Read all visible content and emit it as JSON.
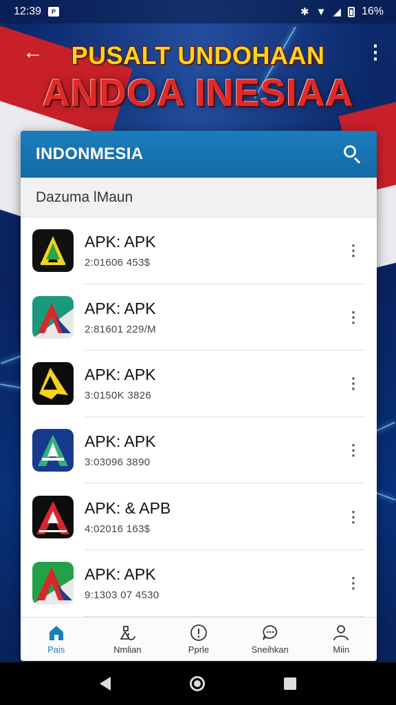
{
  "status_bar": {
    "time": "12:39",
    "battery_text": "16%"
  },
  "header": {
    "title_line1": "PUSALT UNDOHAAN",
    "title_line2": "ANDOA INESIAA"
  },
  "card": {
    "title": "INDONMESIA",
    "subheader": "Dazuma lMaun"
  },
  "apps": [
    {
      "name": "APK: APK",
      "meta": "2:01606  453$",
      "icon": "app-icon-green-yellow"
    },
    {
      "name": "APK: APK",
      "meta": "2:81601  229/M",
      "icon": "app-icon-teal-red"
    },
    {
      "name": "APK: APK",
      "meta": "3:0150K  3826",
      "icon": "app-icon-yellow-black"
    },
    {
      "name": "APK: APK",
      "meta": "3:03096  3890",
      "icon": "app-icon-blue-green"
    },
    {
      "name": "APK: & APB",
      "meta": "4:02016  163$",
      "icon": "app-icon-red-black"
    },
    {
      "name": "APK: APK",
      "meta": "9:1303 07  4530",
      "icon": "app-icon-green-red"
    }
  ],
  "bottom_nav": [
    {
      "label": "Pais",
      "icon": "home-icon",
      "active": true
    },
    {
      "label": "Nmlian",
      "icon": "shapes-icon",
      "active": false
    },
    {
      "label": "Pprle",
      "icon": "info-icon",
      "active": false
    },
    {
      "label": "Sneihkan",
      "icon": "chat-icon",
      "active": false
    },
    {
      "label": "Miin",
      "icon": "person-icon",
      "active": false
    }
  ],
  "colors": {
    "accent": "#1b7dbd",
    "title_yellow": "#ffd21f",
    "title_red": "#e02a2a"
  }
}
